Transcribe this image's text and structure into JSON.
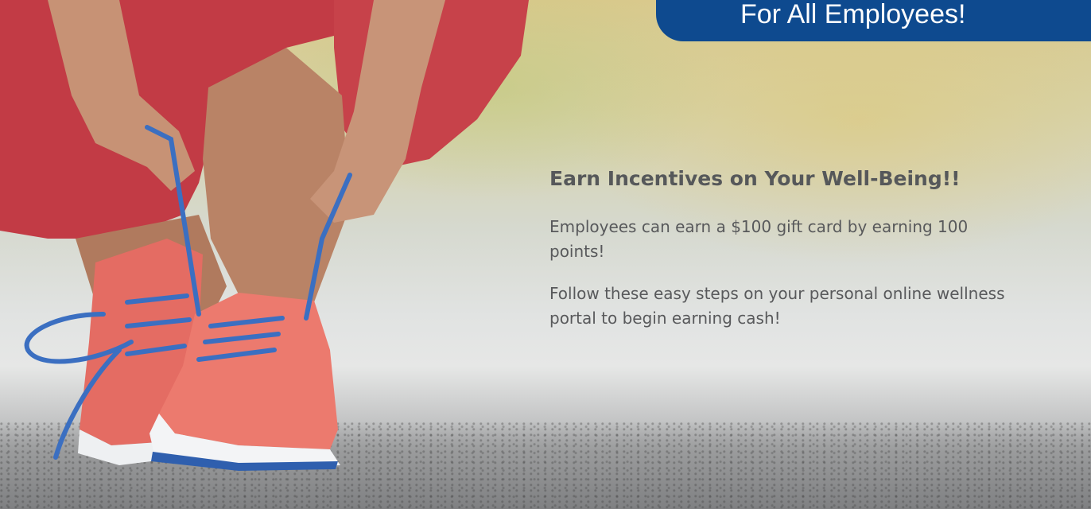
{
  "banner": {
    "text": "For All Employees!"
  },
  "hero": {
    "image": "woman-tying-running-shoe-laces",
    "heading": "Earn Incentives on Your Well-Being!!",
    "paragraph_1": "Employees can earn a $100 gift card by earning 100 points!",
    "paragraph_2": "Follow these easy steps on your personal online wellness portal to begin earning cash!"
  },
  "colors": {
    "banner": "#0e4a8f",
    "text": "#58595b",
    "shoe": "#e8756a",
    "laces": "#3b6fc1"
  }
}
